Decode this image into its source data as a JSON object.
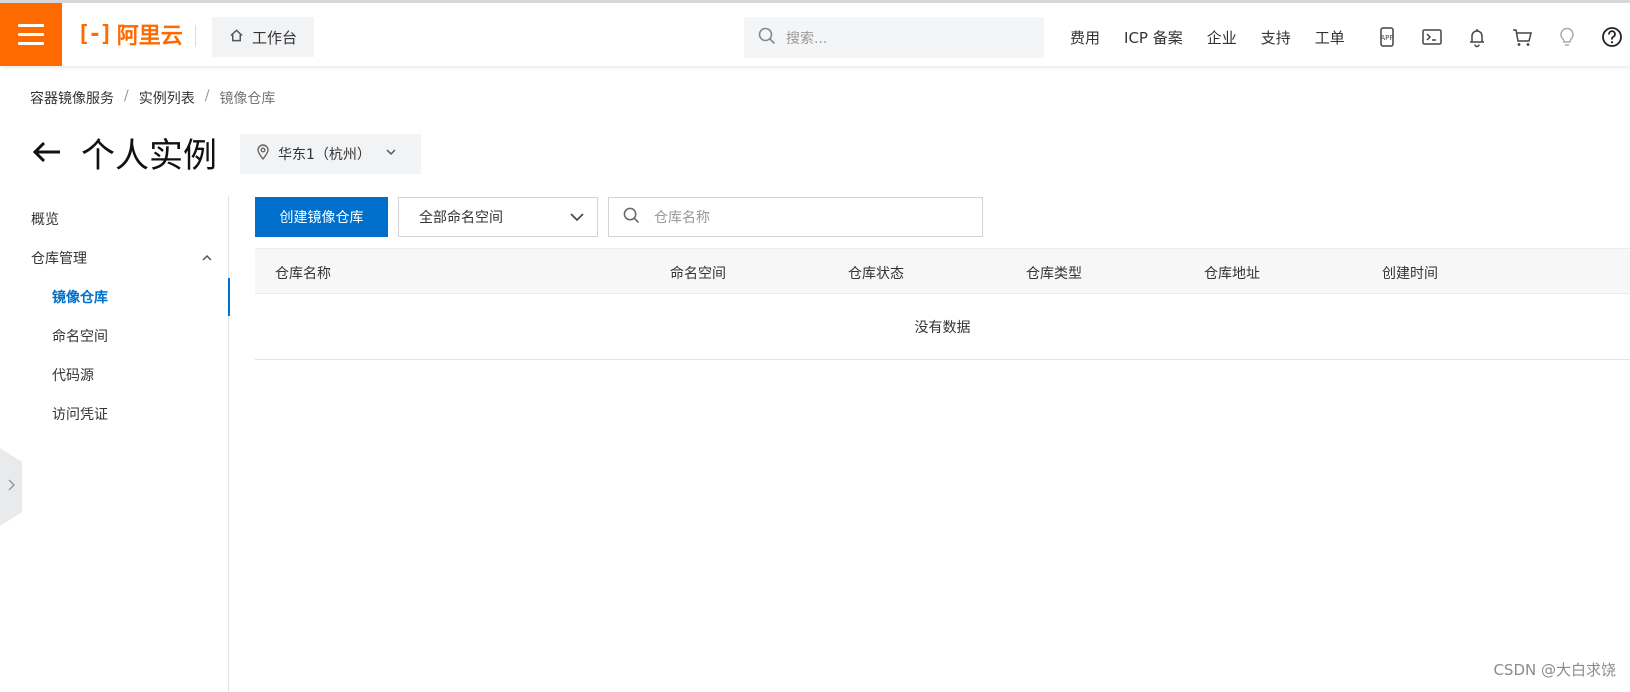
{
  "header": {
    "logo_mark": "[-]",
    "logo_text": "阿里云",
    "workbench_label": "工作台",
    "search_placeholder": "搜索...",
    "links": [
      "费用",
      "ICP 备案",
      "企业",
      "支持",
      "工单"
    ],
    "icons": [
      "app-icon",
      "terminal-icon",
      "bell-icon",
      "cart-icon",
      "bulb-icon",
      "help-icon"
    ],
    "brand_color": "#ff6a00"
  },
  "breadcrumb": {
    "items": [
      "容器镜像服务",
      "实例列表",
      "镜像仓库"
    ],
    "separator": "/"
  },
  "page": {
    "title": "个人实例",
    "region": "华东1（杭州）"
  },
  "sidebar": {
    "overview": "概览",
    "repo_mgmt": "仓库管理",
    "items": [
      "镜像仓库",
      "命名空间",
      "代码源",
      "访问凭证"
    ],
    "active_item": "镜像仓库",
    "accent_color": "#0070cc"
  },
  "toolbar": {
    "create_label": "创建镜像仓库",
    "namespace_select": "全部命名空间",
    "repo_search_placeholder": "仓库名称"
  },
  "table": {
    "columns": [
      "仓库名称",
      "命名空间",
      "仓库状态",
      "仓库类型",
      "仓库地址",
      "创建时间"
    ],
    "empty_text": "没有数据"
  },
  "watermark": "CSDN @大白求饶"
}
